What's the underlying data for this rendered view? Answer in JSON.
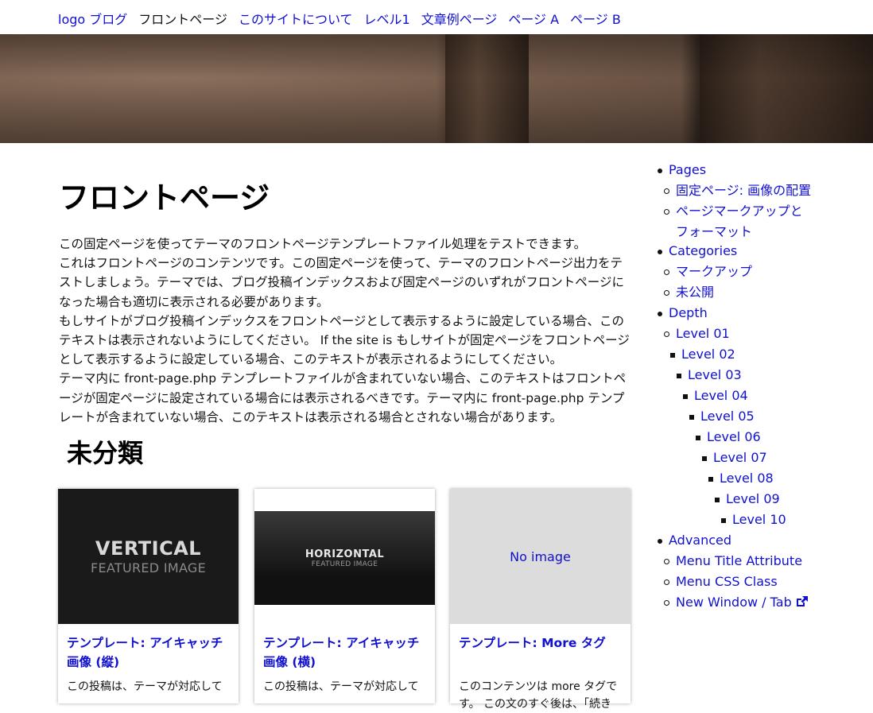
{
  "nav": {
    "items": [
      "logo ブログ",
      "フロントページ",
      "このサイトについて",
      "レベル1",
      "文章例ページ",
      "ページ A",
      "ページ B"
    ],
    "current_index": 1
  },
  "page": {
    "title": "フロントページ",
    "intro": [
      "この固定ページを使ってテーマのフロントページテンプレートファイル処理をテストできます。",
      "これはフロントページのコンテンツです。この固定ページを使って、テーマのフロントページ出力をテストしましょう。テーマでは、ブログ投稿インデックスおよび固定ページのいずれがフロントページになった場合も適切に表示される必要があります。",
      "もしサイトがブログ投稿インデックスをフロントページとして表示するように設定している場合、このテキストは表示されないようにしてください。 If the site is もしサイトが固定ページをフロントページとして表示するように設定している場合、このテキストが表示されるようにしてください。",
      "テーマ内に front-page.php テンプレートファイルが含まれていない場合、このテキストはフロントページが固定ページに設定されている場合には表示されるべきです。テーマ内に front-page.php テンプレートが含まれていない場合、このテキストは表示される場合とされない場合があります。"
    ],
    "section_title": "未分類"
  },
  "cards": [
    {
      "thumb_big": "VERTICAL",
      "thumb_small": "FEATURED IMAGE",
      "title": "テンプレート: アイキャッチ画像 (縦)",
      "excerpt": "この投稿は、テーマが対応して"
    },
    {
      "thumb_big": "HORIZONTAL",
      "thumb_small": "FEATURED IMAGE",
      "title": "テンプレート: アイキャッチ画像 (横)",
      "excerpt": "この投稿は、テーマが対応して"
    },
    {
      "thumb_text": "No image",
      "title": "テンプレート: More タグ",
      "excerpt": "このコンテンツは more タグです。 この文のすぐ後は、「続き"
    }
  ],
  "sidebar": {
    "items": [
      {
        "label": "Pages",
        "bullet": "disc"
      },
      {
        "label": "固定ページ: 画像の配置",
        "bullet": "circle"
      },
      {
        "label": "ページマークアップと",
        "bullet": "circle"
      },
      {
        "label": "フォーマット",
        "bullet": "none"
      },
      {
        "label": "Categories",
        "bullet": "disc"
      },
      {
        "label": "マークアップ",
        "bullet": "circle"
      },
      {
        "label": "未公開",
        "bullet": "circle"
      },
      {
        "label": "Depth",
        "bullet": "disc"
      },
      {
        "label": "Level 01",
        "bullet": "circle"
      },
      {
        "label": "Level 02",
        "bullet": "square"
      },
      {
        "label": "Level 03",
        "bullet": "square"
      },
      {
        "label": "Level 04",
        "bullet": "square"
      },
      {
        "label": "Level 05",
        "bullet": "square"
      },
      {
        "label": "Level 06",
        "bullet": "square"
      },
      {
        "label": "Level 07",
        "bullet": "square"
      },
      {
        "label": "Level 08",
        "bullet": "square"
      },
      {
        "label": "Level 09",
        "bullet": "square"
      },
      {
        "label": "Level 10",
        "bullet": "square"
      },
      {
        "label": "Advanced",
        "bullet": "disc"
      },
      {
        "label": "Menu Title Attribute",
        "bullet": "circle"
      },
      {
        "label": "Menu CSS Class",
        "bullet": "circle"
      },
      {
        "label": "New Window / Tab",
        "bullet": "circle",
        "icon": "external-link-icon"
      }
    ]
  },
  "colors": {
    "link": "#1010d0",
    "text": "#111111"
  }
}
